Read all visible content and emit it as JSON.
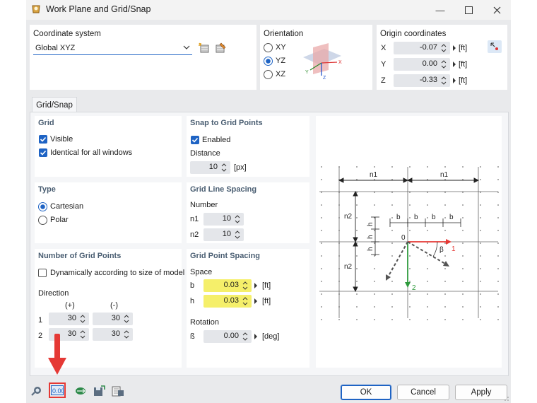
{
  "window": {
    "title": "Work Plane and Grid/Snap"
  },
  "coordinate_system": {
    "title": "Coordinate system",
    "selected": "Global XYZ"
  },
  "orientation": {
    "title": "Orientation",
    "options": [
      "XY",
      "YZ",
      "XZ"
    ],
    "selected": "YZ",
    "axis_labels": [
      "X",
      "Y",
      "Z"
    ]
  },
  "origin": {
    "title": "Origin coordinates",
    "x_label": "X",
    "x_value": "-0.07",
    "x_unit": "[ft]",
    "y_label": "Y",
    "y_value": "0.00",
    "y_unit": "[ft]",
    "z_label": "Z",
    "z_value": "-0.33",
    "z_unit": "[ft]"
  },
  "tab": {
    "label": "Grid/Snap"
  },
  "grid": {
    "title": "Grid",
    "visible_label": "Visible",
    "visible_checked": true,
    "identical_label": "Identical for all windows",
    "identical_checked": true
  },
  "snap": {
    "title": "Snap to Grid Points",
    "enabled_label": "Enabled",
    "enabled_checked": true,
    "distance_label": "Distance",
    "distance_value": "10",
    "distance_unit": "[px]"
  },
  "type": {
    "title": "Type",
    "options": [
      "Cartesian",
      "Polar"
    ],
    "selected": "Cartesian"
  },
  "line_spacing": {
    "title": "Grid Line Spacing",
    "number_label": "Number",
    "n1_label": "n1",
    "n1_value": "10",
    "n2_label": "n2",
    "n2_value": "10"
  },
  "num_points": {
    "title": "Number of Grid Points",
    "dynamic_label": "Dynamically according to size of model",
    "dynamic_checked": false,
    "direction_label": "Direction",
    "plus_header": "(+)",
    "minus_header": "(-)",
    "row1_label": "1",
    "row1_plus": "30",
    "row1_minus": "30",
    "row2_label": "2",
    "row2_plus": "30",
    "row2_minus": "30"
  },
  "point_spacing": {
    "title": "Grid Point Spacing",
    "space_label": "Space",
    "b_label": "b",
    "b_value": "0.03",
    "b_unit": "[ft]",
    "h_label": "h",
    "h_value": "0.03",
    "h_unit": "[ft]",
    "rotation_label": "Rotation",
    "beta_label": "ß",
    "beta_value": "0.00",
    "beta_unit": "[deg]"
  },
  "diagram": {
    "n1_left": "n1",
    "n1_right": "n1",
    "n2_top": "n2",
    "n2_bottom": "n2",
    "b": "b",
    "h": "h",
    "origin": "0",
    "beta": "β",
    "axis1": "1",
    "axis2": "2"
  },
  "footer": {
    "ok_label": "OK",
    "cancel_label": "Cancel",
    "apply_label": "Apply",
    "icons": [
      "search-icon",
      "decimal-places-icon",
      "units-icon",
      "save-settings-icon",
      "load-settings-icon"
    ]
  },
  "colors": {
    "highlight": "#f5ef6a",
    "accent": "#1e63c4",
    "annotation": "#e53935"
  }
}
